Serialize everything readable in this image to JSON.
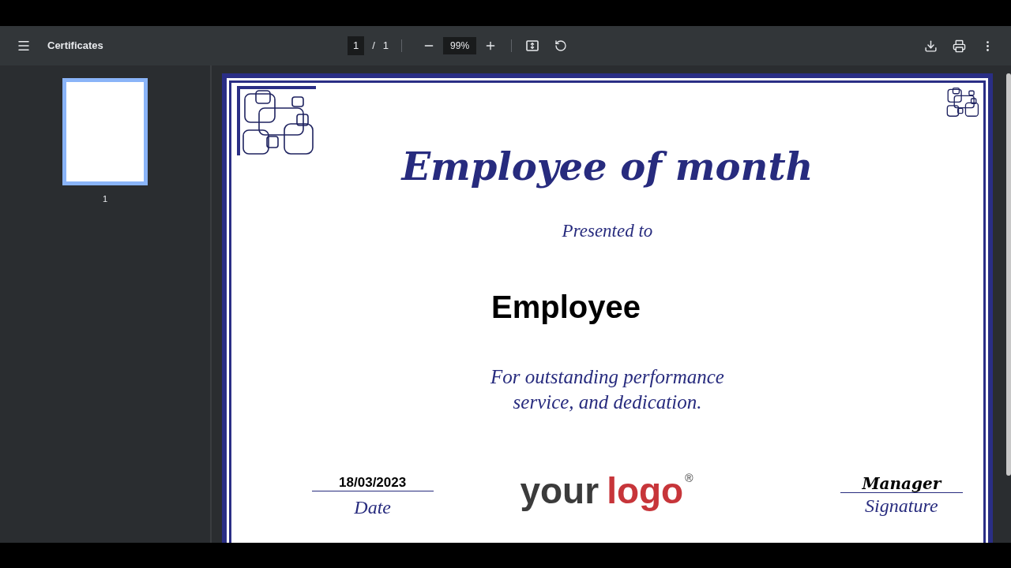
{
  "toolbar": {
    "title": "Certificates",
    "page_current": "1",
    "page_separator": "/",
    "page_total": "1",
    "zoom": "99%"
  },
  "sidebar": {
    "thumbnails": [
      {
        "label": "1",
        "selected": true
      }
    ]
  },
  "certificate": {
    "heading": "Employee of month",
    "presented": "Presented to",
    "name": "Employee",
    "citation_lines": [
      "For outstanding performance",
      "service, and dedication."
    ],
    "date": "18/03/2023",
    "date_caption": "Date",
    "logo_part_1": "your",
    "logo_part_2": "logo",
    "logo_mark": "®",
    "signature": "Manager",
    "signature_caption": "Signature"
  }
}
